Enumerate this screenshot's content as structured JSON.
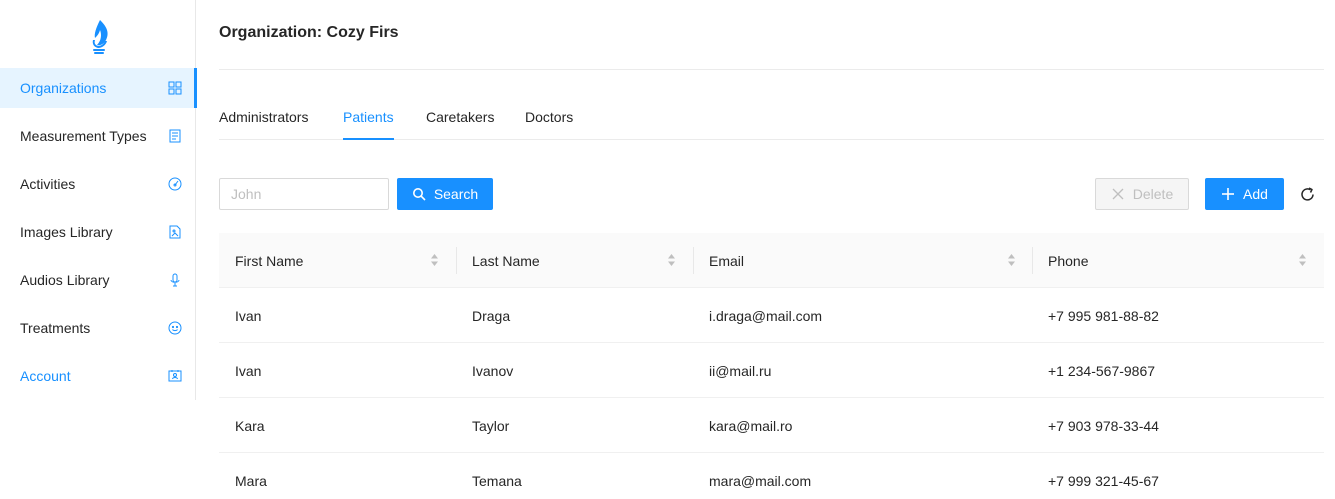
{
  "sidebar": {
    "logo_icon": "hand-flame-icon",
    "items": [
      {
        "label": "Organizations",
        "icon": "dashboard-grid-icon",
        "state": "active"
      },
      {
        "label": "Measurement Types",
        "icon": "book-icon",
        "state": "normal"
      },
      {
        "label": "Activities",
        "icon": "gauge-icon",
        "state": "normal"
      },
      {
        "label": "Images Library",
        "icon": "file-image-icon",
        "state": "normal"
      },
      {
        "label": "Audios Library",
        "icon": "microphone-icon",
        "state": "normal"
      },
      {
        "label": "Treatments",
        "icon": "smile-icon",
        "state": "normal"
      },
      {
        "label": "Account",
        "icon": "id-card-icon",
        "state": "highlight"
      }
    ]
  },
  "header": {
    "title": "Organization: Cozy Firs"
  },
  "tabs": [
    {
      "label": "Administrators",
      "active": false
    },
    {
      "label": "Patients",
      "active": true
    },
    {
      "label": "Caretakers",
      "active": false
    },
    {
      "label": "Doctors",
      "active": false
    }
  ],
  "toolbar": {
    "search_placeholder": "John",
    "search_value": "",
    "search_label": "Search",
    "delete_label": "Delete",
    "add_label": "Add",
    "reload_icon": "reload-icon"
  },
  "table": {
    "columns": [
      "First Name",
      "Last Name",
      "Email",
      "Phone"
    ],
    "rows": [
      [
        "Ivan",
        "Draga",
        "i.draga@mail.com",
        "+7 995 981-88-82"
      ],
      [
        "Ivan",
        "Ivanov",
        "ii@mail.ru",
        "+1 234-567-9867"
      ],
      [
        "Kara",
        "Taylor",
        "kara@mail.ro",
        "+7 903 978-33-44"
      ],
      [
        "Mara",
        "Temana",
        "mara@mail.com",
        "+7 999 321-45-67"
      ]
    ]
  },
  "colors": {
    "accent": "#1890ff",
    "active_bg": "#e6f4ff",
    "text": "#262626",
    "header_bg": "#fafafa",
    "border": "#f0f0f0",
    "disabled_text": "#bfbfbf"
  }
}
